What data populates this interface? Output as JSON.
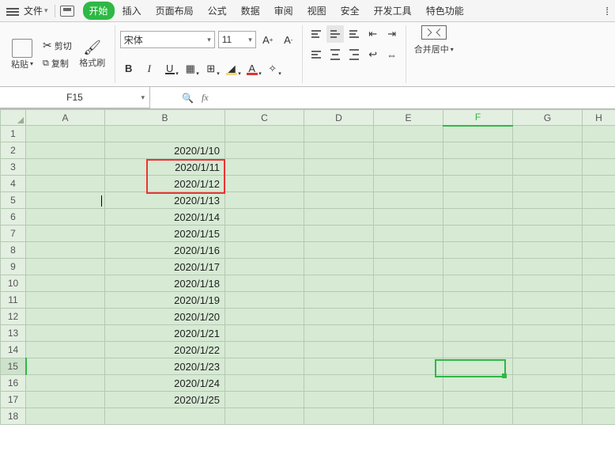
{
  "menu": {
    "file": "文件",
    "tabs": [
      "开始",
      "插入",
      "页面布局",
      "公式",
      "数据",
      "审阅",
      "视图",
      "安全",
      "开发工具",
      "特色功能"
    ]
  },
  "clipboard": {
    "paste": "粘贴",
    "cut": "剪切",
    "copy": "复制",
    "format_painter": "格式刷"
  },
  "font": {
    "name": "宋体",
    "size": "11"
  },
  "merge": {
    "label": "合并居中"
  },
  "namebox": "F15",
  "columns": [
    "A",
    "B",
    "C",
    "D",
    "E",
    "F",
    "G",
    "H"
  ],
  "rows": [
    {
      "n": 1,
      "b": ""
    },
    {
      "n": 2,
      "b": "2020/1/10"
    },
    {
      "n": 3,
      "b": "2020/1/11"
    },
    {
      "n": 4,
      "b": "2020/1/12"
    },
    {
      "n": 5,
      "b": "2020/1/13"
    },
    {
      "n": 6,
      "b": "2020/1/14"
    },
    {
      "n": 7,
      "b": "2020/1/15"
    },
    {
      "n": 8,
      "b": "2020/1/16"
    },
    {
      "n": 9,
      "b": "2020/1/17"
    },
    {
      "n": 10,
      "b": "2020/1/18"
    },
    {
      "n": 11,
      "b": "2020/1/19"
    },
    {
      "n": 12,
      "b": "2020/1/20"
    },
    {
      "n": 13,
      "b": "2020/1/21"
    },
    {
      "n": 14,
      "b": "2020/1/22"
    },
    {
      "n": 15,
      "b": "2020/1/23"
    },
    {
      "n": 16,
      "b": "2020/1/24"
    },
    {
      "n": 17,
      "b": "2020/1/25"
    },
    {
      "n": 18,
      "b": ""
    }
  ],
  "selected": {
    "col": "F",
    "row": 15
  },
  "highlight": {
    "rows": [
      3,
      4
    ]
  }
}
